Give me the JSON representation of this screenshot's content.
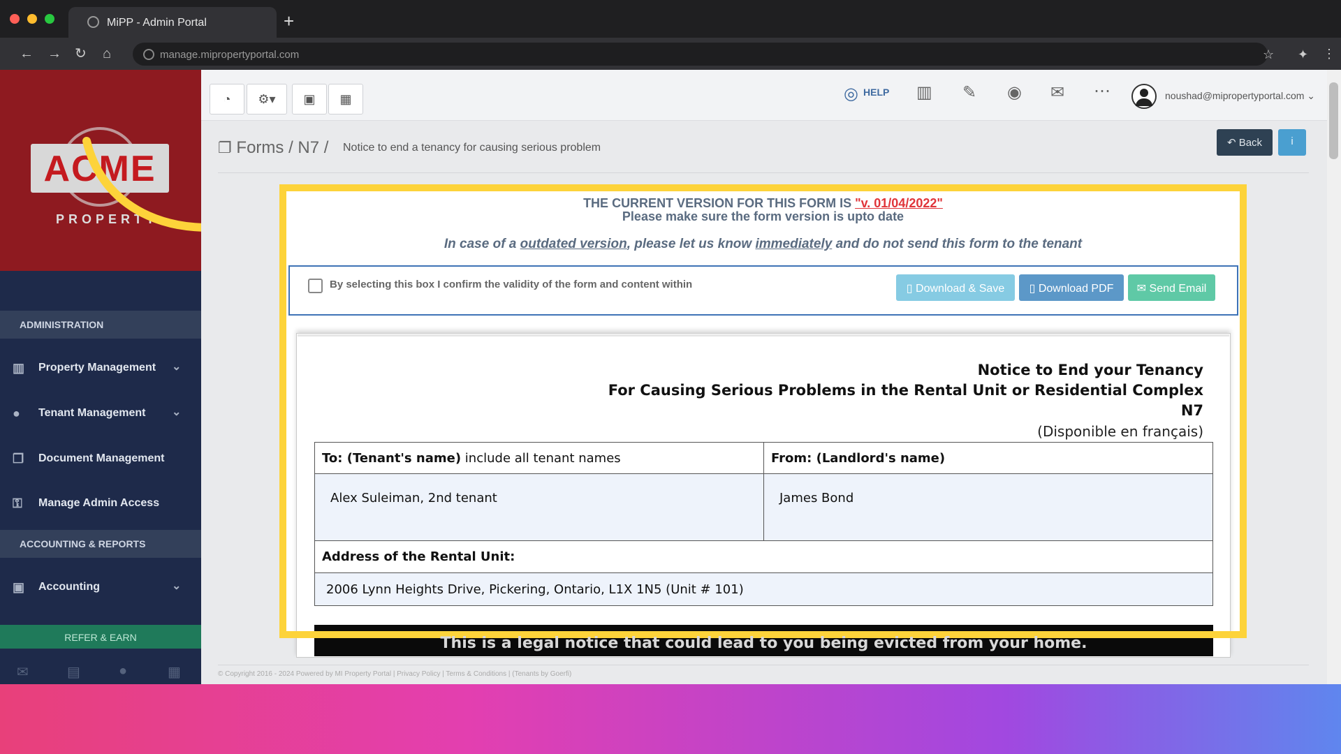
{
  "browser": {
    "tab_title": "MiPP - Admin Portal",
    "new_tab": "+",
    "url": "manage.mipropertyportal.com"
  },
  "sidebar": {
    "logo_text": "ACME",
    "logo_sub": "PROPERTY",
    "section_admin": "ADMINISTRATION",
    "items": [
      {
        "label": "Property Management",
        "icon": "building-icon"
      },
      {
        "label": "Tenant Management",
        "icon": "users-icon"
      },
      {
        "label": "Document Management",
        "icon": "documents-icon"
      },
      {
        "label": "Manage Admin Access",
        "icon": "key-icon"
      }
    ],
    "section_accounting": "ACCOUNTING & REPORTS",
    "accounting": {
      "label": "Accounting",
      "icon": "money-icon"
    },
    "refer": "REFER & EARN"
  },
  "topbar": {
    "help": "HELP",
    "user": "noushad@mipropertyportal.com"
  },
  "breadcrumb": {
    "root": "Forms",
    "sep": "/",
    "code": "N7",
    "title": "Notice to end a tenancy for causing serious problem"
  },
  "header_buttons": {
    "back": "Back",
    "info": "i"
  },
  "version_notice": {
    "prefix": "THE CURRENT VERSION FOR THIS FORM IS ",
    "version": "\"v. 01/04/2022\"",
    "line2": "Please make sure the form version is upto date",
    "line3_a": "In case of a ",
    "line3_link1": "outdated version",
    "line3_b": ", please let us know ",
    "line3_link2": "immediately",
    "line3_c": " and do not send this form to the tenant"
  },
  "confirm": {
    "label": "By selecting this box I confirm the validity of the form and content within",
    "checked": false
  },
  "actions": {
    "download_save": "Download & Save",
    "download_pdf": "Download PDF",
    "send_email": "Send Email"
  },
  "document": {
    "title1": "Notice to End your Tenancy",
    "title2": "For Causing Serious Problems in the Rental Unit or Residential Complex",
    "code": "N7",
    "french": "(Disponible en français)",
    "to_label_bold": "To: (Tenant's name)",
    "to_label_rest": " include all tenant names",
    "from_label": "From: (Landlord's name)",
    "tenant_name": "Alex Suleiman, 2nd  tenant",
    "landlord_name": "James Bond",
    "address_label": "Address of the Rental Unit:",
    "address": "2006 Lynn Heights Drive, Pickering, Ontario, L1X 1N5 (Unit # 101)",
    "banner": "This is a legal notice that could lead to you being evicted from your home."
  },
  "footer": {
    "text": "© Copyright 2016 - 2024 Powered by MI Property Portal | Privacy Policy | Terms & Conditions | (Tenants by Goerfi)"
  },
  "colors": {
    "sidebar": "#1e2a4a",
    "logo_bg": "#8e1a20",
    "highlight": "#fdd33a",
    "version_red": "#e0353a"
  }
}
